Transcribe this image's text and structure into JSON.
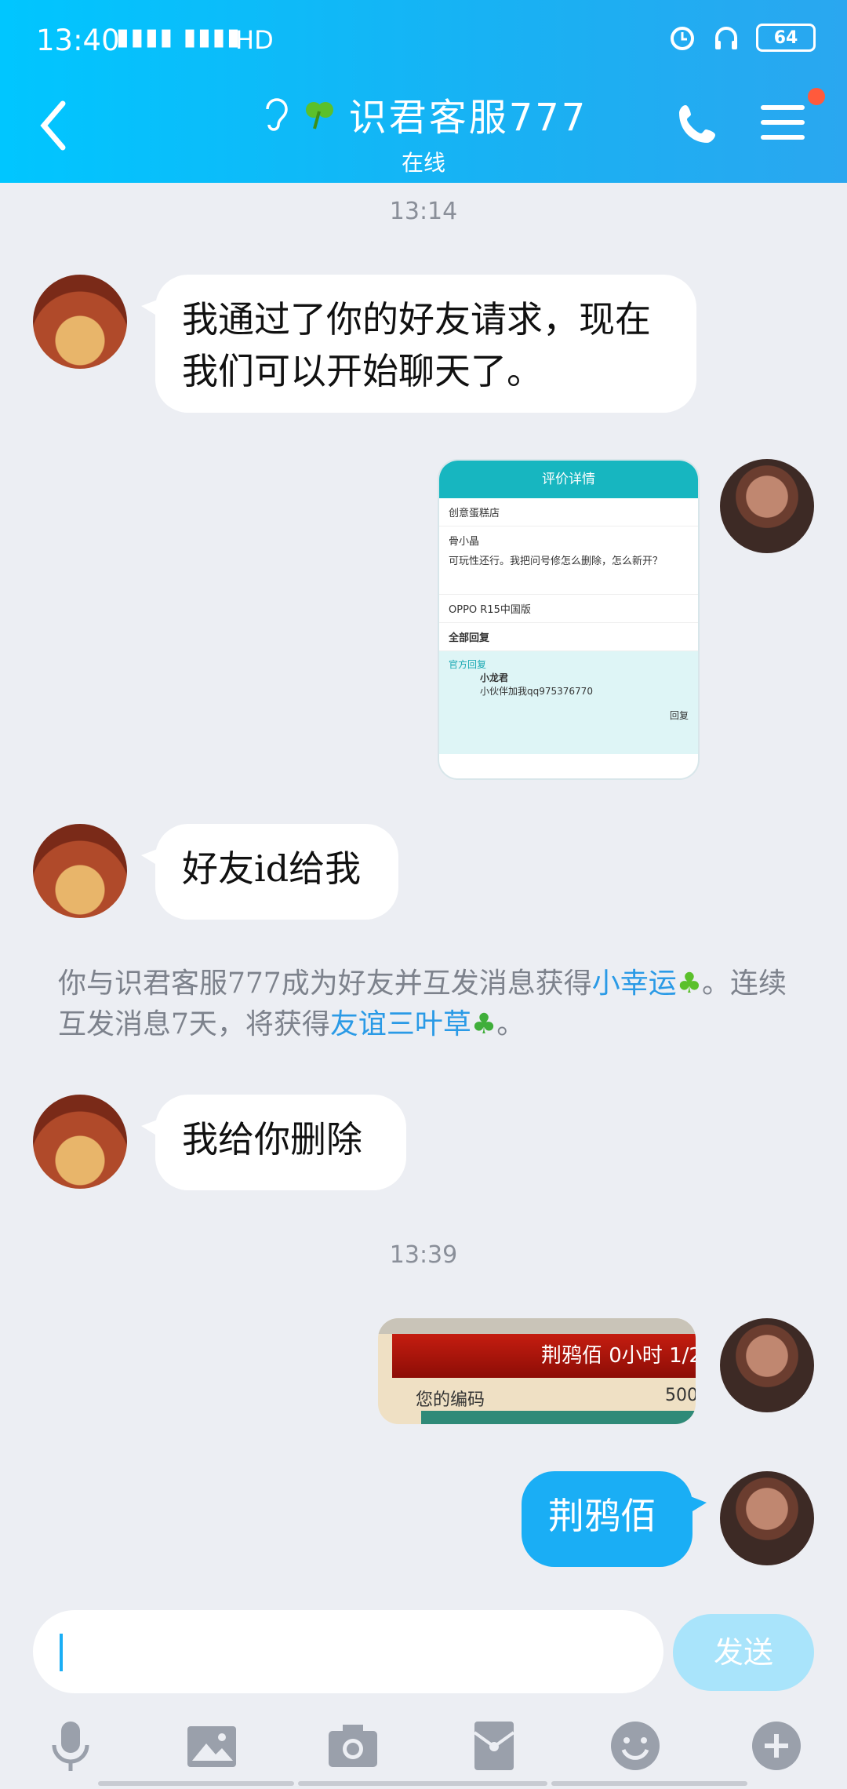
{
  "status_bar": {
    "time": "13:40",
    "signal": "3G 4G",
    "network": "HD",
    "battery": "64"
  },
  "header": {
    "title": "识君客服777",
    "subtitle": "在线",
    "icons": [
      "back-icon",
      "ear-icon",
      "clover-icon",
      "phone-icon",
      "menu-icon"
    ]
  },
  "messages": {
    "t1": "13:14",
    "m1": "我通过了你的好友请求，现在我们可以开始聊天了。",
    "m2": "好友id给我",
    "sys": {
      "part1": "你与识君客服777成为好友并互发消息获得",
      "link1": "小幸运",
      "part2": "。连续互发消息7天，将获得",
      "link2": "友谊三叶草",
      "part3": "。"
    },
    "m3": "我给你删除",
    "t2": "13:39",
    "m4": "荆鸦佰"
  },
  "image_card": {
    "title": "评价详情",
    "shop": "创意蛋糕店",
    "user": "骨小晶",
    "comment": "可玩性还行。我把问号修怎么删除，怎么新开？",
    "device": "OPPO R15中国版",
    "replies_label": "全部回复",
    "official": "官方回复",
    "replier": "小龙君",
    "reply_text": "小伙伴加我qq975376770",
    "reply_btn": "回复"
  },
  "game_image": {
    "bar_text": "荆鸦佰 0小时 1/2",
    "row_label": "您的编码",
    "row_value": "500"
  },
  "input": {
    "placeholder": "",
    "send_label": "发送"
  },
  "toolbar": [
    "mic-icon",
    "image-icon",
    "camera-icon",
    "redpacket-icon",
    "emoji-icon",
    "plus-icon"
  ]
}
